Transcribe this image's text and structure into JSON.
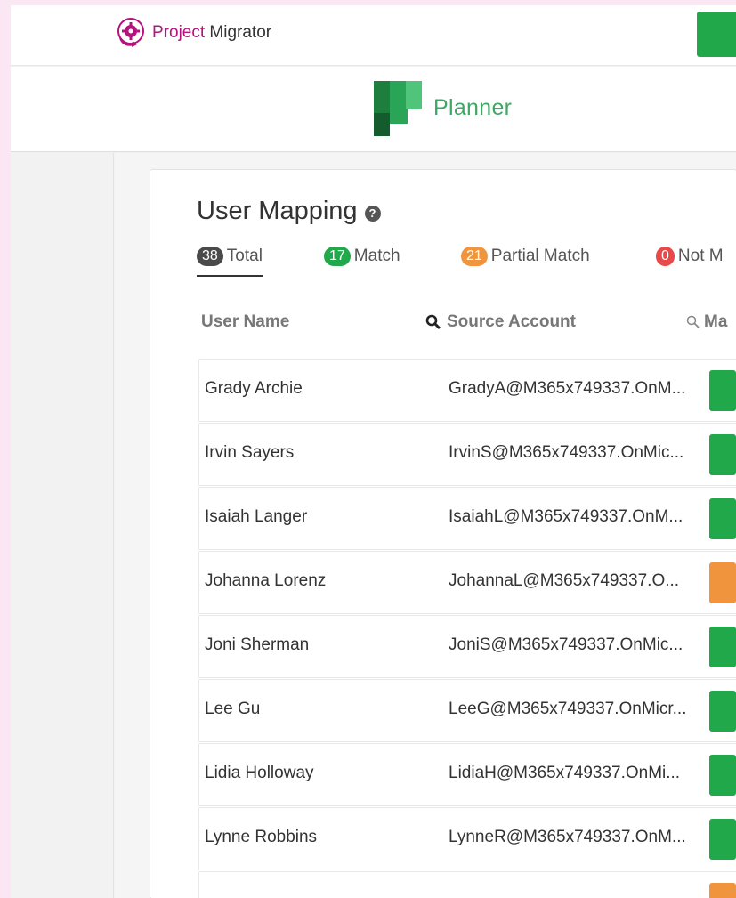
{
  "app": {
    "brand_prefix": "Project",
    "brand_suffix": " Migrator",
    "planner_label": "Planner"
  },
  "colors": {
    "brand": "#b5127e",
    "match": "#21a84a",
    "partial": "#f0953d",
    "not_matched": "#e84a4a",
    "total": "#4a4a4a"
  },
  "mapping": {
    "title": "User Mapping",
    "help_icon": "question-circle-icon",
    "filters": [
      {
        "count": "38",
        "label": "Total",
        "color": "#4a4a4a"
      },
      {
        "count": "17",
        "label": "Match",
        "color": "#21a84a"
      },
      {
        "count": "21",
        "label": "Partial Match",
        "color": "#f0953d"
      },
      {
        "count": "0",
        "label": "Not M",
        "color": "#e84a4a"
      }
    ],
    "columns": {
      "user_name": "User Name",
      "source_account": "Source Account",
      "mapped": "Ma"
    },
    "rows": [
      {
        "name": "Grady Archie",
        "source": "GradyA@M365x749337.OnM...",
        "status": "match"
      },
      {
        "name": "Irvin Sayers",
        "source": "IrvinS@M365x749337.OnMic...",
        "status": "match"
      },
      {
        "name": "Isaiah Langer",
        "source": "IsaiahL@M365x749337.OnM...",
        "status": "match"
      },
      {
        "name": "Johanna Lorenz",
        "source": "JohannaL@M365x749337.O...",
        "status": "partial"
      },
      {
        "name": "Joni Sherman",
        "source": "JoniS@M365x749337.OnMic...",
        "status": "match"
      },
      {
        "name": "Lee Gu",
        "source": "LeeG@M365x749337.OnMicr...",
        "status": "match"
      },
      {
        "name": "Lidia Holloway",
        "source": "LidiaH@M365x749337.OnMi...",
        "status": "match"
      },
      {
        "name": "Lynne Robbins",
        "source": "LynneR@M365x749337.OnM...",
        "status": "match"
      },
      {
        "name": "",
        "source": "",
        "status": "partial"
      }
    ]
  }
}
